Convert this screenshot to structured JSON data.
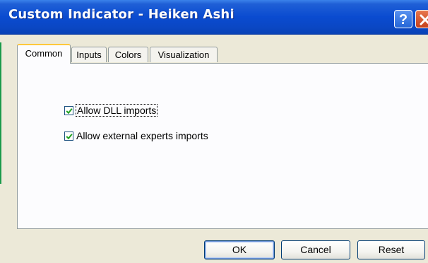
{
  "window": {
    "title": "Custom Indicator - Heiken Ashi",
    "help_glyph": "?",
    "close_icon": "close-x-icon",
    "help_icon": "question-mark-icon"
  },
  "tabs": [
    {
      "label": "Common",
      "active": true
    },
    {
      "label": "Inputs",
      "active": false
    },
    {
      "label": "Colors",
      "active": false
    },
    {
      "label": "Visualization",
      "active": false
    }
  ],
  "options": {
    "allow_dll": {
      "label": "Allow DLL imports",
      "checked": true
    },
    "allow_external": {
      "label": "Allow external experts imports",
      "checked": true
    }
  },
  "buttons": {
    "ok": "OK",
    "cancel": "Cancel",
    "reset": "Reset"
  },
  "colors": {
    "title_bar": "#0a4bd0",
    "active_tab_highlight": "#ffc83c",
    "close_button": "#c4401c",
    "check_mark": "#21a121"
  }
}
